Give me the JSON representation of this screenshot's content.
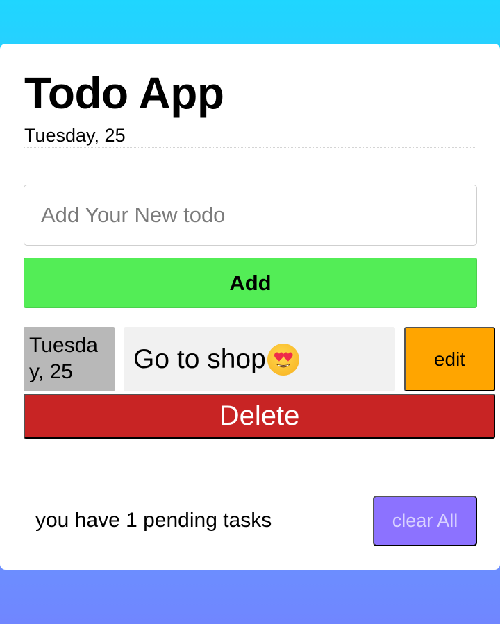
{
  "app": {
    "title": "Todo App",
    "date": "Tuesday, 25"
  },
  "input": {
    "placeholder": "Add Your New todo",
    "value": ""
  },
  "buttons": {
    "add_label": "Add",
    "clear_all_label": "clear All"
  },
  "todos": [
    {
      "date": "Tuesday, 25",
      "text": "Go to shop",
      "emoji_icon": "heart-eyes-emoji-icon",
      "edit_label": "edit",
      "delete_label": "Delete"
    }
  ],
  "footer": {
    "pending_text": "you have 1 pending tasks"
  },
  "colors": {
    "add": "#53ed56",
    "edit": "#ffa500",
    "delete": "#c82424",
    "clear_all": "#8c72ff",
    "todo_date_bg": "#b8b8b8",
    "todo_text_bg": "#f1f1f1"
  }
}
